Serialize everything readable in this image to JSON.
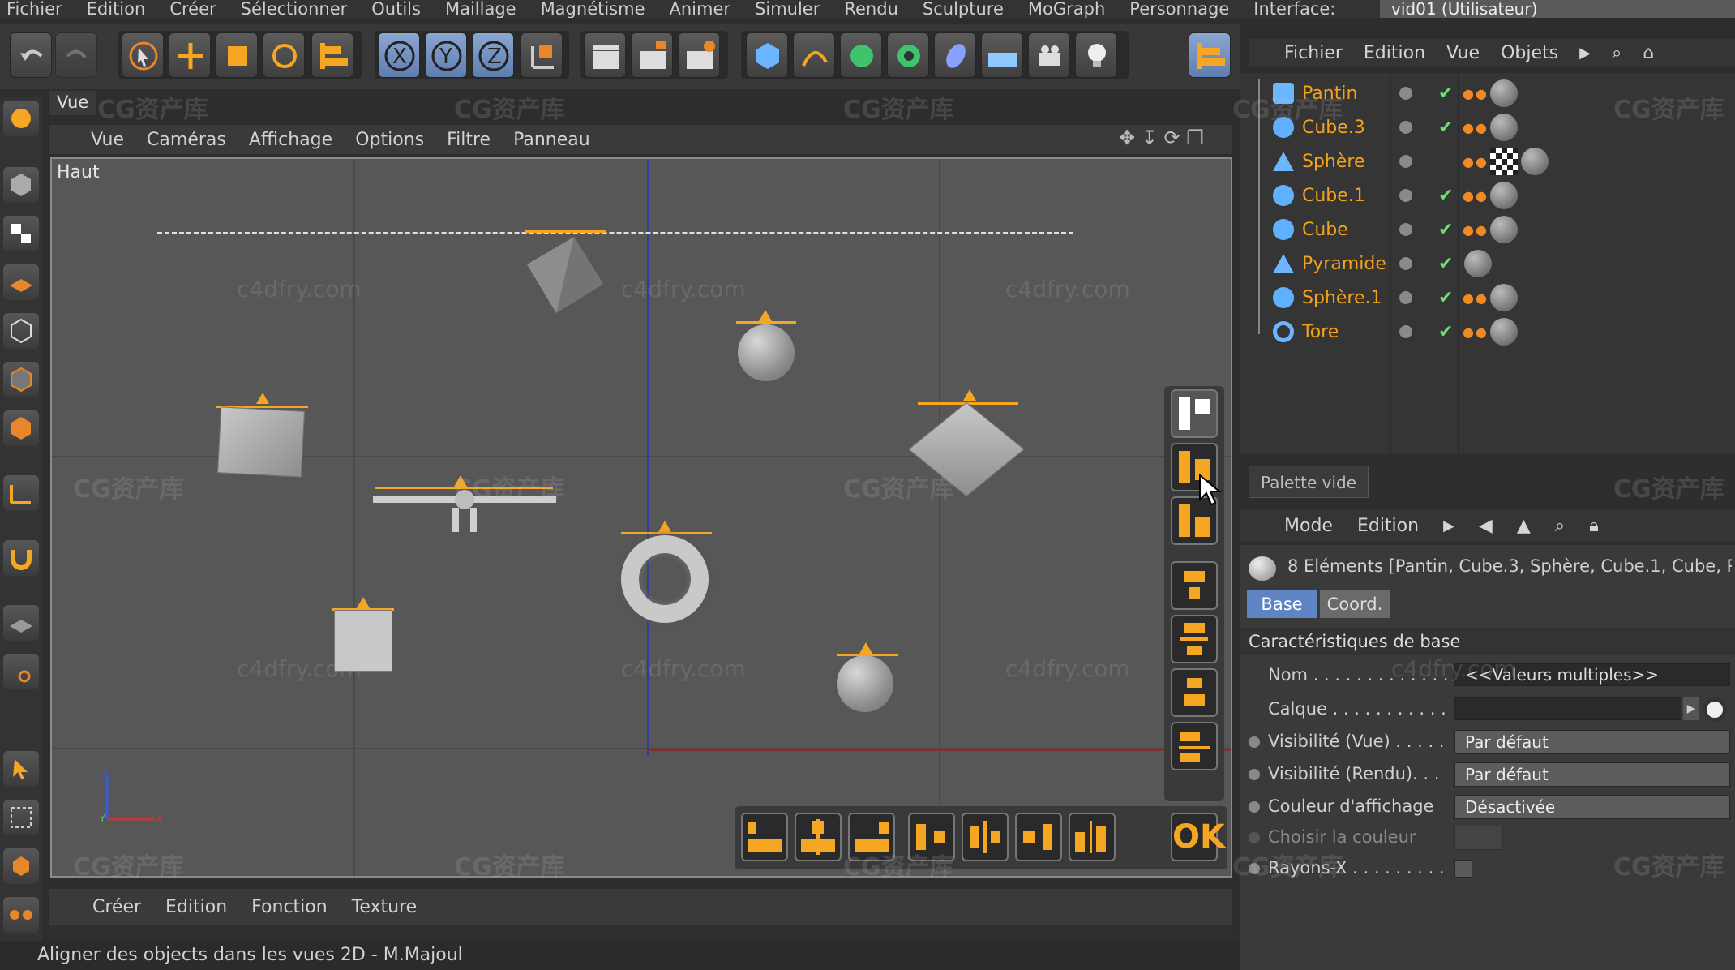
{
  "menubar": {
    "items": [
      "Fichier",
      "Edition",
      "Créer",
      "Sélectionner",
      "Outils",
      "Maillage",
      "Magnétisme",
      "Animer",
      "Simuler",
      "Rendu",
      "Sculpture",
      "MoGraph",
      "Personnage",
      "Interface:"
    ],
    "interface_value": "vid01 (Utilisateur)"
  },
  "viewport": {
    "tab": "Vue",
    "menu": [
      "Vue",
      "Caméras",
      "Affichage",
      "Options",
      "Filtre",
      "Panneau"
    ],
    "view_name": "Haut",
    "ok_label": "OK"
  },
  "object_manager": {
    "menu": [
      "Fichier",
      "Edition",
      "Vue",
      "Objets"
    ],
    "objects": [
      {
        "name": "Pantin",
        "icon": "figure-icon"
      },
      {
        "name": "Cube.3",
        "icon": "cube-icon"
      },
      {
        "name": "Sphère",
        "icon": "cone-icon"
      },
      {
        "name": "Cube.1",
        "icon": "cube-icon"
      },
      {
        "name": "Cube",
        "icon": "cube-icon"
      },
      {
        "name": "Pyramide",
        "icon": "pyramid-icon"
      },
      {
        "name": "Sphère.1",
        "icon": "sphere-icon"
      },
      {
        "name": "Tore",
        "icon": "torus-icon"
      }
    ],
    "palette_tab": "Palette vide"
  },
  "attributes": {
    "menu": [
      "Mode",
      "Edition"
    ],
    "selection": "8 Eléments [Pantin, Cube.3, Sphère, Cube.1, Cube, P",
    "tabs": [
      "Base",
      "Coord."
    ],
    "section": "Caractéristiques de base",
    "fields": {
      "nom_label": "Nom . . . . . . . . . . . . .",
      "nom_value": "<<Valeurs multiples>>",
      "calque_label": "Calque . . . . . . . . . . .",
      "vis_vue_label": "Visibilité (Vue) . . . . .",
      "vis_vue_value": "Par défaut",
      "vis_rendu_label": "Visibilité (Rendu). . .",
      "vis_rendu_value": "Par défaut",
      "couleur_label": "Couleur d'affichage",
      "couleur_value": "Désactivée",
      "choisir_label": "Choisir la couleur",
      "rayons_label": "Rayons-X . . . . . . . . ."
    }
  },
  "bottom_menu": [
    "Créer",
    "Edition",
    "Fonction",
    "Texture"
  ],
  "status": "Aligner des objects dans les vues 2D - M.Majoul",
  "watermarks": {
    "cg": "CG资产库",
    "site": "c4dfry.com"
  },
  "colors": {
    "accent": "#f5a623",
    "object_name": "#f3a21c"
  }
}
